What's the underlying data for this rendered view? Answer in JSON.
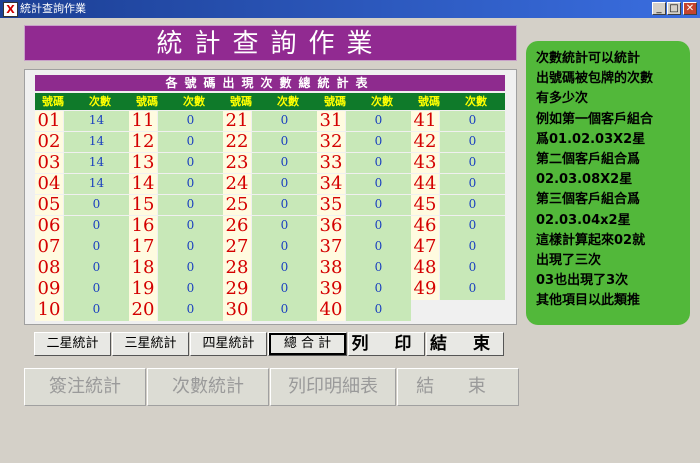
{
  "window": {
    "title": "統計查詢作業",
    "min": "_",
    "max": "□",
    "close": "✕"
  },
  "banner": "統計查詢作業",
  "table": {
    "title": "各號碼出現次數總統計表",
    "col_number": "號碼",
    "col_count": "次數",
    "columns": [
      {
        "rows": [
          {
            "n": "01",
            "c": "14"
          },
          {
            "n": "02",
            "c": "14"
          },
          {
            "n": "03",
            "c": "14"
          },
          {
            "n": "04",
            "c": "14"
          },
          {
            "n": "05",
            "c": "0"
          },
          {
            "n": "06",
            "c": "0"
          },
          {
            "n": "07",
            "c": "0"
          },
          {
            "n": "08",
            "c": "0"
          },
          {
            "n": "09",
            "c": "0"
          },
          {
            "n": "10",
            "c": "0"
          }
        ]
      },
      {
        "rows": [
          {
            "n": "11",
            "c": "0"
          },
          {
            "n": "12",
            "c": "0"
          },
          {
            "n": "13",
            "c": "0"
          },
          {
            "n": "14",
            "c": "0"
          },
          {
            "n": "15",
            "c": "0"
          },
          {
            "n": "16",
            "c": "0"
          },
          {
            "n": "17",
            "c": "0"
          },
          {
            "n": "18",
            "c": "0"
          },
          {
            "n": "19",
            "c": "0"
          },
          {
            "n": "20",
            "c": "0"
          }
        ]
      },
      {
        "rows": [
          {
            "n": "21",
            "c": "0"
          },
          {
            "n": "22",
            "c": "0"
          },
          {
            "n": "23",
            "c": "0"
          },
          {
            "n": "24",
            "c": "0"
          },
          {
            "n": "25",
            "c": "0"
          },
          {
            "n": "26",
            "c": "0"
          },
          {
            "n": "27",
            "c": "0"
          },
          {
            "n": "28",
            "c": "0"
          },
          {
            "n": "29",
            "c": "0"
          },
          {
            "n": "30",
            "c": "0"
          }
        ]
      },
      {
        "rows": [
          {
            "n": "31",
            "c": "0"
          },
          {
            "n": "32",
            "c": "0"
          },
          {
            "n": "33",
            "c": "0"
          },
          {
            "n": "34",
            "c": "0"
          },
          {
            "n": "35",
            "c": "0"
          },
          {
            "n": "36",
            "c": "0"
          },
          {
            "n": "37",
            "c": "0"
          },
          {
            "n": "38",
            "c": "0"
          },
          {
            "n": "39",
            "c": "0"
          },
          {
            "n": "40",
            "c": "0"
          }
        ]
      },
      {
        "rows": [
          {
            "n": "41",
            "c": "0"
          },
          {
            "n": "42",
            "c": "0"
          },
          {
            "n": "43",
            "c": "0"
          },
          {
            "n": "44",
            "c": "0"
          },
          {
            "n": "45",
            "c": "0"
          },
          {
            "n": "46",
            "c": "0"
          },
          {
            "n": "47",
            "c": "0"
          },
          {
            "n": "48",
            "c": "0"
          },
          {
            "n": "49",
            "c": "0"
          }
        ]
      }
    ]
  },
  "buttons": {
    "two_star": "二星統計",
    "three_star": "三星統計",
    "four_star": "四星統計",
    "combined": "總 合 計",
    "print": "列 印",
    "finish": "結 束"
  },
  "lower_buttons": {
    "bet_stats": "簽注統計",
    "count_stats": "次數統計",
    "print_detail": "列印明細表",
    "end": "結 束"
  },
  "info_lines": [
    "次數統計可以統計",
    "出號碼被包牌的次數",
    "有多少次",
    "例如第一個客戶組合",
    "爲01.02.03X2星",
    "第二個客戶組合爲",
    "02.03.08X2星",
    "第三個客戶組合爲",
    "02.03.04x2星",
    "這樣計算起來02就",
    "出現了三次",
    "03也出現了3次",
    "其他項目以此類推"
  ]
}
